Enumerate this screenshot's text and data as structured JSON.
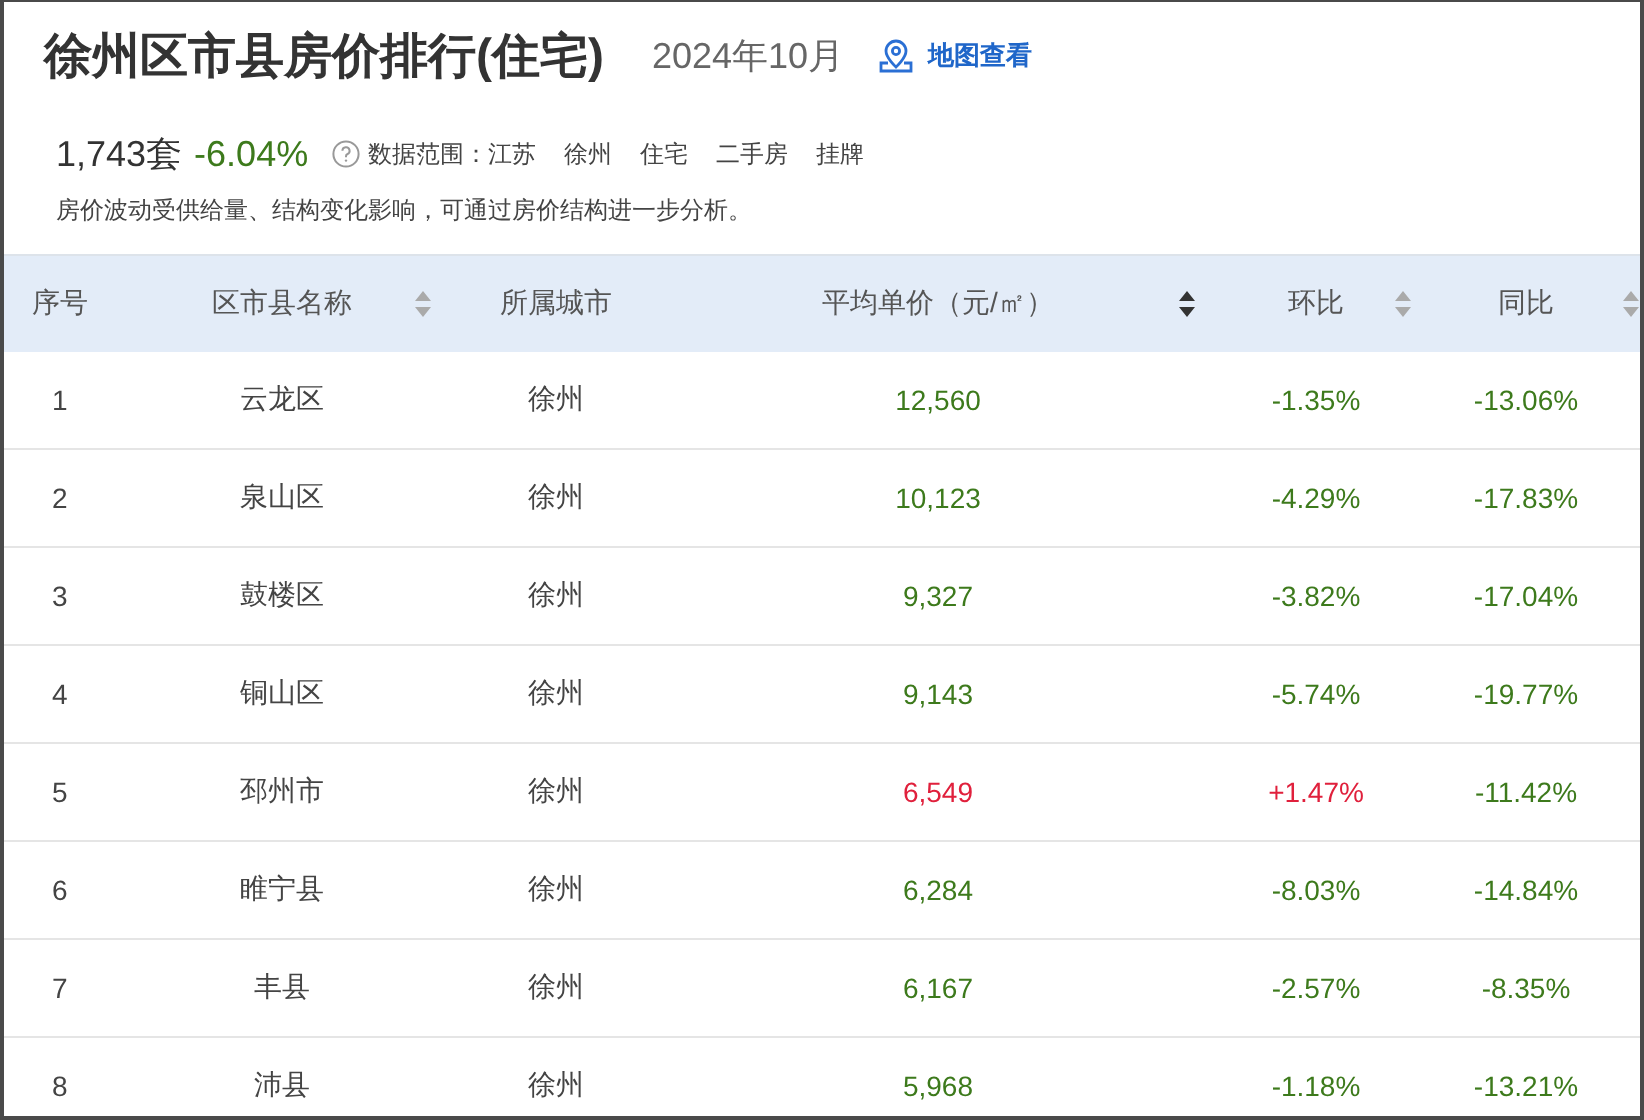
{
  "header": {
    "title": "徐州区市县房价排行(住宅)",
    "period": "2024年10月",
    "map_link": "地图查看"
  },
  "summary": {
    "count": "1,743套",
    "change": "-6.04%",
    "change_rising": false,
    "scope_label": "数据范围：",
    "scope_tags": [
      "江苏",
      "徐州",
      "住宅",
      "二手房",
      "挂牌"
    ]
  },
  "note": "房价波动受供给量、结构变化影响，可通过房价结构进一步分析。",
  "table": {
    "columns": [
      {
        "label": "序号",
        "sortable": false,
        "sorted": false
      },
      {
        "label": "区市县名称",
        "sortable": true,
        "sorted": false
      },
      {
        "label": "所属城市",
        "sortable": false,
        "sorted": false
      },
      {
        "label": "平均单价（元/㎡）",
        "sortable": true,
        "sorted": true
      },
      {
        "label": "环比",
        "sortable": true,
        "sorted": false
      },
      {
        "label": "同比",
        "sortable": true,
        "sorted": false
      }
    ],
    "rows": [
      {
        "rank": "1",
        "name": "云龙区",
        "city": "徐州",
        "price": "12,560",
        "mom": "-1.35%",
        "mom_rising": false,
        "yoy": "-13.06%",
        "yoy_rising": false
      },
      {
        "rank": "2",
        "name": "泉山区",
        "city": "徐州",
        "price": "10,123",
        "mom": "-4.29%",
        "mom_rising": false,
        "yoy": "-17.83%",
        "yoy_rising": false
      },
      {
        "rank": "3",
        "name": "鼓楼区",
        "city": "徐州",
        "price": "9,327",
        "mom": "-3.82%",
        "mom_rising": false,
        "yoy": "-17.04%",
        "yoy_rising": false
      },
      {
        "rank": "4",
        "name": "铜山区",
        "city": "徐州",
        "price": "9,143",
        "mom": "-5.74%",
        "mom_rising": false,
        "yoy": "-19.77%",
        "yoy_rising": false
      },
      {
        "rank": "5",
        "name": "邳州市",
        "city": "徐州",
        "price": "6,549",
        "mom": "+1.47%",
        "mom_rising": true,
        "yoy": "-11.42%",
        "yoy_rising": false
      },
      {
        "rank": "6",
        "name": "睢宁县",
        "city": "徐州",
        "price": "6,284",
        "mom": "-8.03%",
        "mom_rising": false,
        "yoy": "-14.84%",
        "yoy_rising": false
      },
      {
        "rank": "7",
        "name": "丰县",
        "city": "徐州",
        "price": "6,167",
        "mom": "-2.57%",
        "mom_rising": false,
        "yoy": "-8.35%",
        "yoy_rising": false
      },
      {
        "rank": "8",
        "name": "沛县",
        "city": "徐州",
        "price": "5,968",
        "mom": "-1.18%",
        "mom_rising": false,
        "yoy": "-13.21%",
        "yoy_rising": false
      }
    ]
  }
}
